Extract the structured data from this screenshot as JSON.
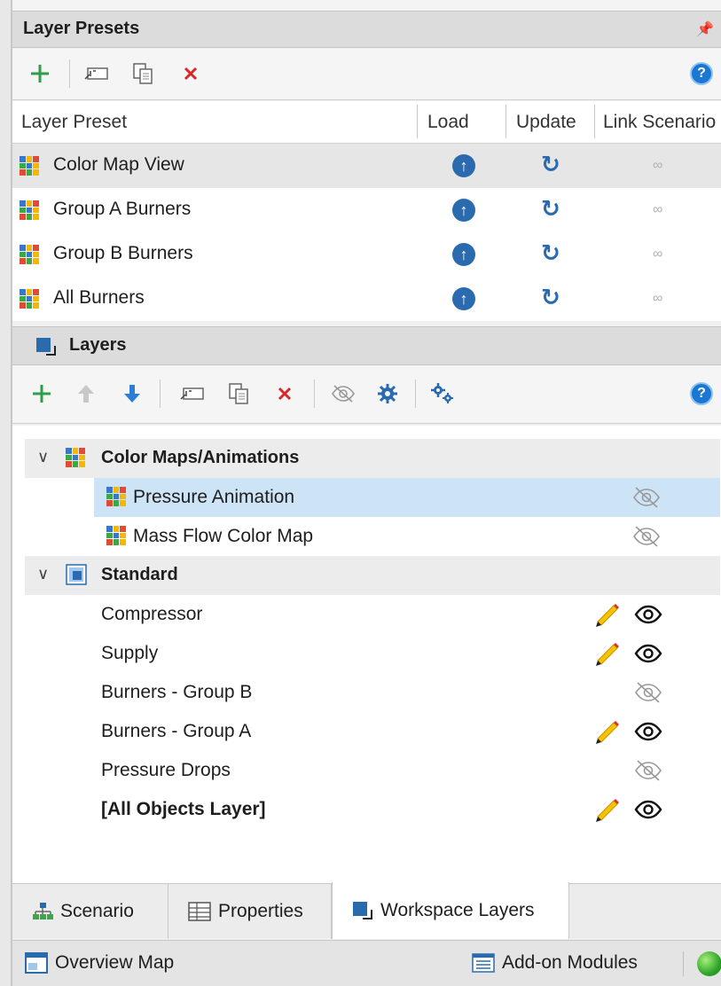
{
  "presets": {
    "title": "Layer Presets",
    "pin_icon": "pin-icon",
    "toolbar": [
      "add-icon",
      "rename-icon",
      "copy-icon",
      "delete-icon",
      "help-icon"
    ],
    "columns": [
      "Layer Preset",
      "Load",
      "Update",
      "Link Scenario"
    ],
    "rows": [
      {
        "label": "Color Map View",
        "selected": true
      },
      {
        "label": "Group A Burners",
        "selected": false
      },
      {
        "label": "Group B Burners",
        "selected": false
      },
      {
        "label": "All Burners",
        "selected": false
      }
    ]
  },
  "layers": {
    "title": "Layers",
    "groups": [
      {
        "label": "Color Maps/Animations",
        "items": [
          {
            "label": "Pressure Animation",
            "selected": true,
            "edit": false,
            "visible": false
          },
          {
            "label": "Mass Flow Color Map",
            "selected": false,
            "edit": false,
            "visible": false
          }
        ]
      },
      {
        "label": "Standard",
        "items": [
          {
            "label": "Compressor",
            "edit": true,
            "visible": true
          },
          {
            "label": "Supply",
            "edit": true,
            "visible": true
          },
          {
            "label": "Burners - Group B",
            "edit": false,
            "visible": false
          },
          {
            "label": "Burners - Group A",
            "edit": true,
            "visible": true
          },
          {
            "label": "Pressure Drops",
            "edit": false,
            "visible": false
          },
          {
            "label": "[All Objects Layer]",
            "edit": true,
            "visible": true,
            "bold": true
          }
        ]
      }
    ]
  },
  "tabs": [
    {
      "label": "Scenario",
      "active": false
    },
    {
      "label": "Properties",
      "active": false
    },
    {
      "label": "Workspace Layers",
      "active": true
    }
  ],
  "statusbar": {
    "overview": "Overview Map",
    "addon": "Add-on Modules"
  },
  "colors": {
    "accent_blue": "#2a6bb0",
    "selection": "#cde4f7",
    "add_green": "#2e9e4a",
    "delete_red": "#d9262a"
  }
}
